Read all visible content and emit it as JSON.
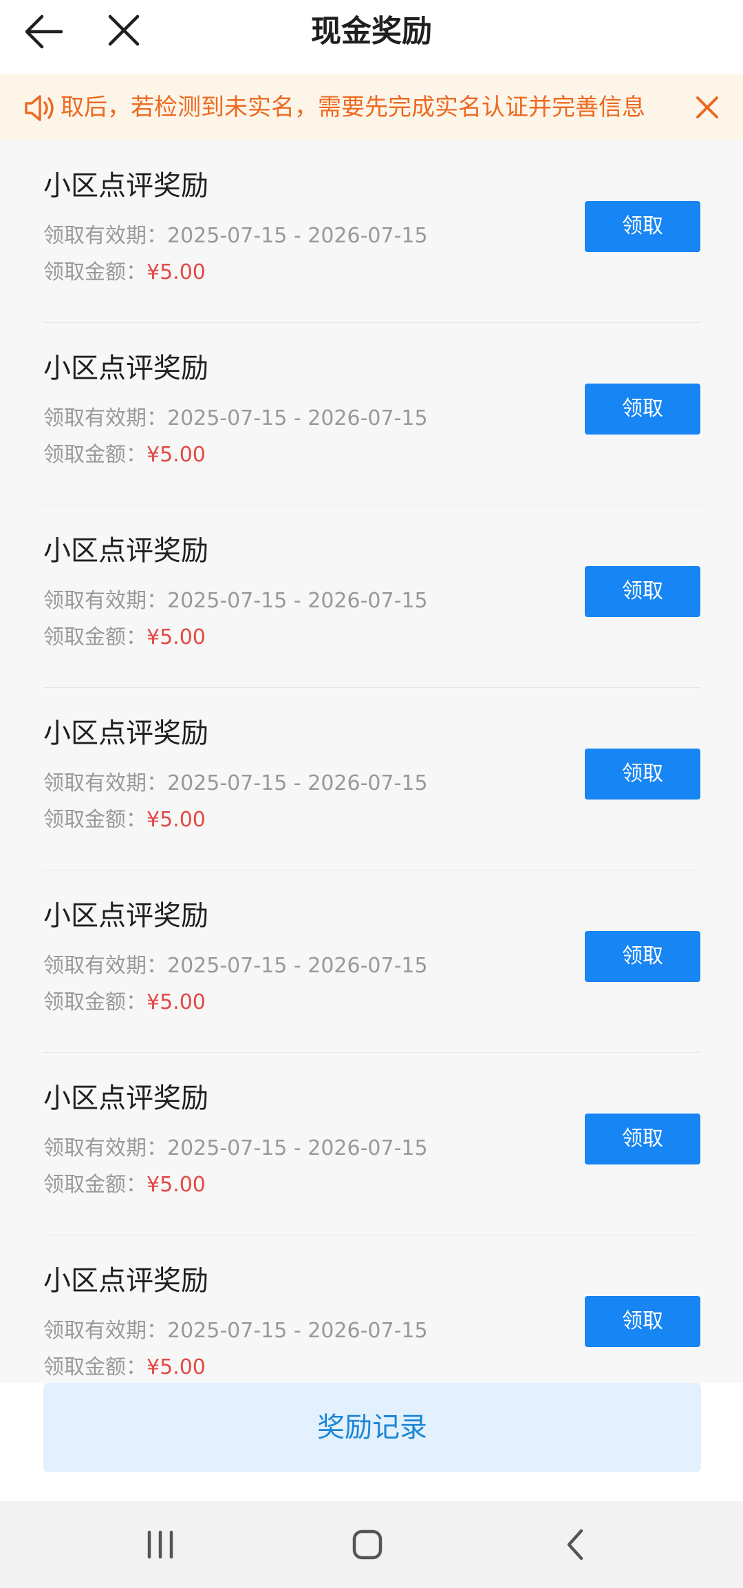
{
  "header": {
    "title": "现金奖励"
  },
  "notice": {
    "text": "取后，若检测到未实名，需要先完成实名认证并完善信息",
    "accent_color": "#ec6a21",
    "background_color": "#fef5e9"
  },
  "rewards": {
    "items": [
      {
        "title": "小区点评奖励",
        "period_label": "领取有效期：",
        "period_value": "2025-07-15 - 2026-07-15",
        "amount_label": "领取金额：",
        "amount_value": "¥5.00",
        "button_label": "领取"
      },
      {
        "title": "小区点评奖励",
        "period_label": "领取有效期：",
        "period_value": "2025-07-15 - 2026-07-15",
        "amount_label": "领取金额：",
        "amount_value": "¥5.00",
        "button_label": "领取"
      },
      {
        "title": "小区点评奖励",
        "period_label": "领取有效期：",
        "period_value": "2025-07-15 - 2026-07-15",
        "amount_label": "领取金额：",
        "amount_value": "¥5.00",
        "button_label": "领取"
      },
      {
        "title": "小区点评奖励",
        "period_label": "领取有效期：",
        "period_value": "2025-07-15 - 2026-07-15",
        "amount_label": "领取金额：",
        "amount_value": "¥5.00",
        "button_label": "领取"
      },
      {
        "title": "小区点评奖励",
        "period_label": "领取有效期：",
        "period_value": "2025-07-15 - 2026-07-15",
        "amount_label": "领取金额：",
        "amount_value": "¥5.00",
        "button_label": "领取"
      },
      {
        "title": "小区点评奖励",
        "period_label": "领取有效期：",
        "period_value": "2025-07-15 - 2026-07-15",
        "amount_label": "领取金额：",
        "amount_value": "¥5.00",
        "button_label": "领取"
      },
      {
        "title": "小区点评奖励",
        "period_label": "领取有效期：",
        "period_value": "2025-07-15 - 2026-07-15",
        "amount_label": "领取金额：",
        "amount_value": "¥5.00",
        "button_label": "领取"
      }
    ],
    "button_color": "#1785f3",
    "amount_color": "#e24a46"
  },
  "footer": {
    "records_label": "奖励记录"
  },
  "icons": {
    "back": "arrow-left-icon",
    "close": "close-icon",
    "speaker": "speaker-icon",
    "notice_close": "close-icon",
    "nav_recents": "recents-icon",
    "nav_home": "home-icon",
    "nav_back": "chevron-left-icon"
  }
}
